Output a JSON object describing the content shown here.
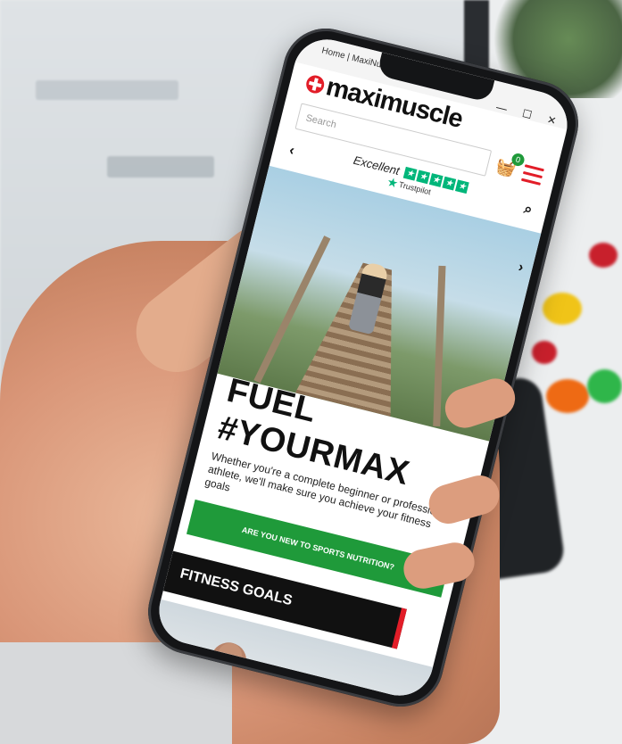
{
  "browser": {
    "tab_title": "Home | MaxiNutrition",
    "minimize_icon": "minimize-icon",
    "maximize_icon": "maximize-icon",
    "close_icon": "close-icon"
  },
  "site": {
    "logo_text": "maximuscle",
    "search_placeholder": "Search",
    "basket_count": "0"
  },
  "trust": {
    "rating_word": "Excellent",
    "brand": "Trustpilot",
    "stars": 5
  },
  "hero": {
    "title": "FUEL #YOURMAX",
    "subtitle": "Whether you're a complete beginner or professional athlete, we'll make sure you achieve your fitness goals",
    "cta_label": "ARE YOU NEW TO SPORTS NUTRITION?"
  },
  "sections": {
    "fitness_goals": "FITNESS GOALS"
  },
  "colors": {
    "brand_red": "#e21d28",
    "brand_green": "#1f9a3a",
    "trustpilot_green": "#00b67a"
  }
}
